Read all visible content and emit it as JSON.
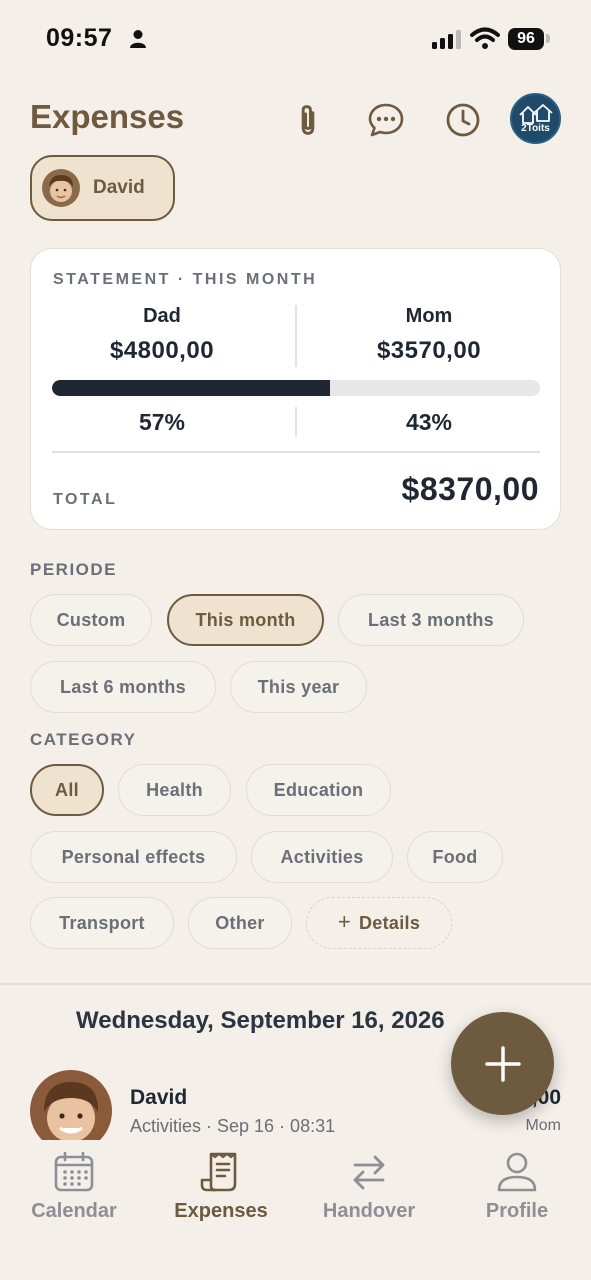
{
  "status_bar": {
    "time": "09:57",
    "battery": "96"
  },
  "header": {
    "title": "Expenses",
    "brand": "2Toits"
  },
  "child": {
    "name": "David"
  },
  "statement": {
    "label": "STATEMENT · THIS MONTH",
    "left": {
      "name": "Dad",
      "amount": "$4800,00",
      "percent": "57%"
    },
    "right": {
      "name": "Mom",
      "amount": "$3570,00",
      "percent": "43%"
    },
    "progress_fraction": 0.57,
    "total_label": "TOTAL",
    "total_amount": "$8370,00"
  },
  "periode": {
    "label": "PERIODE",
    "options": [
      "Custom",
      "This month",
      "Last 3 months",
      "Last 6 months",
      "This year"
    ],
    "selected": "This month"
  },
  "category": {
    "label": "CATEGORY",
    "options": [
      "All",
      "Health",
      "Education",
      "Personal effects",
      "Activities",
      "Food",
      "Transport",
      "Other"
    ],
    "selected": "All",
    "details_label": "Details"
  },
  "expenses": {
    "day_header": "Wednesday, September 16, 2026",
    "items": [
      {
        "name": "David",
        "meta": "Activities · Sep 16 · 08:31",
        "amount": "$55,00",
        "payer": "Mom"
      }
    ]
  },
  "tabs": [
    {
      "label": "Calendar",
      "icon": "calendar-icon"
    },
    {
      "label": "Expenses",
      "icon": "receipt-icon",
      "active": true
    },
    {
      "label": "Handover",
      "icon": "swap-icon"
    },
    {
      "label": "Profile",
      "icon": "user-icon"
    }
  ],
  "colors": {
    "accent": "#6e5a3e",
    "accent_bg": "#efe2cf",
    "background": "#f4efe8",
    "ink": "#1f2733"
  }
}
